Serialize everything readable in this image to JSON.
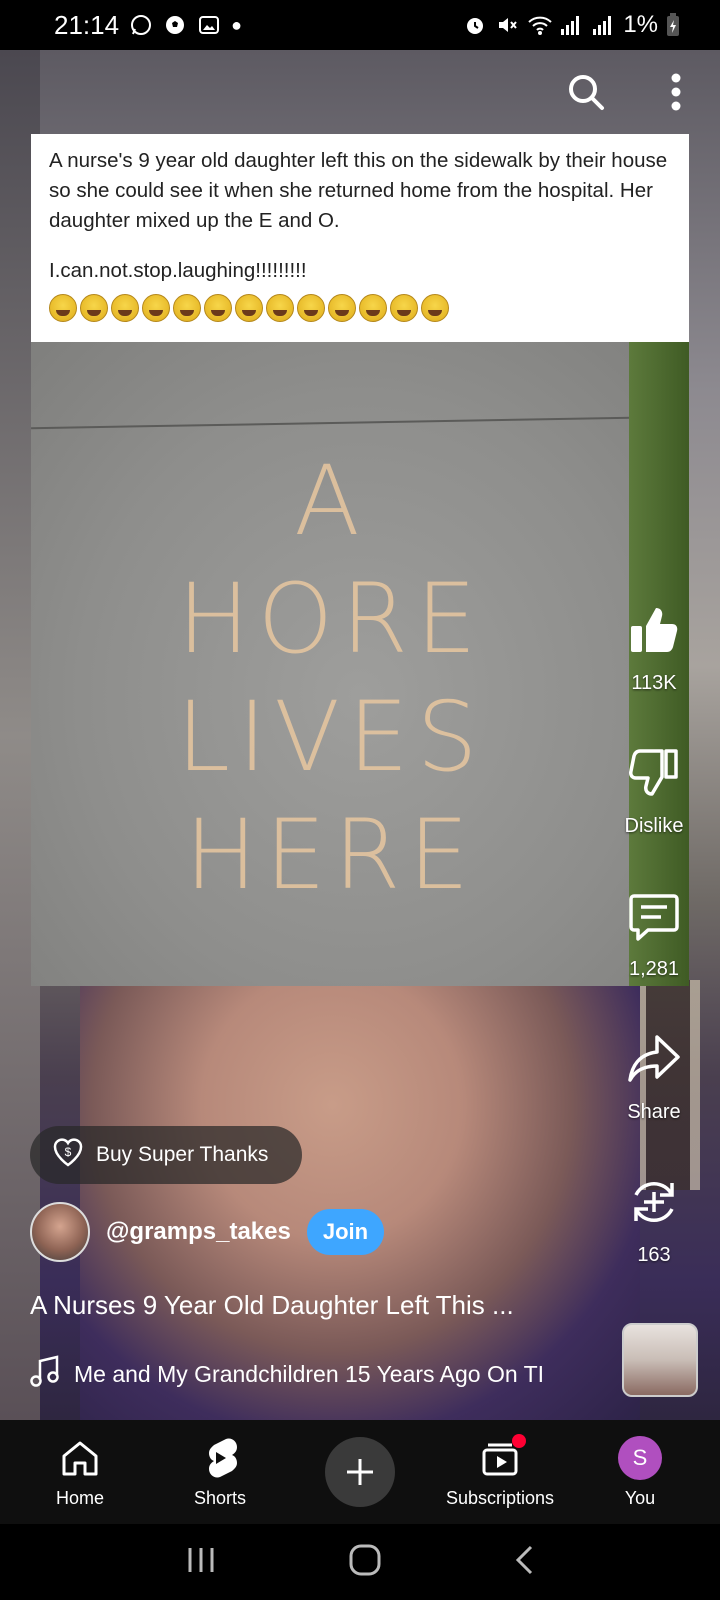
{
  "status_bar": {
    "time": "21:14",
    "battery": "1%"
  },
  "post": {
    "caption_line1": "A nurse's 9 year old daughter left this on the sidewalk by their house so she could see it when she returned home from the hospital. Her daughter mixed up the E and O.",
    "caption_line2": "I.can.not.stop.laughing!!!!!!!!!",
    "emoji_count": 13,
    "chalk_lines": [
      "A",
      "HORE",
      "LIVES",
      "HERE"
    ]
  },
  "actions": {
    "likes": "113K",
    "dislike": "Dislike",
    "comments": "1,281",
    "share": "Share",
    "remix": "163"
  },
  "super_thanks": "Buy Super Thanks",
  "channel": {
    "handle": "@gramps_takes",
    "join": "Join"
  },
  "video_title": "A Nurses 9 Year Old Daughter Left This ...",
  "music": "Me and My Grandchildren 15 Years Ago On TI",
  "nav": {
    "home": "Home",
    "shorts": "Shorts",
    "subscriptions": "Subscriptions",
    "you": "You",
    "you_initial": "S"
  },
  "icons": [
    "search-icon",
    "more-vert-icon",
    "thumbs-up-icon",
    "thumbs-down-icon",
    "comment-icon",
    "share-icon",
    "remix-icon",
    "music-note-icon",
    "home-icon",
    "shorts-icon",
    "add-icon",
    "subscriptions-icon"
  ]
}
